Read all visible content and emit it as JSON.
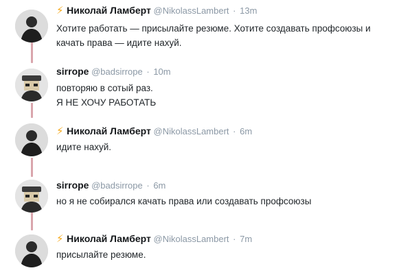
{
  "tweets": [
    {
      "author": "Николай Ламберт",
      "handle": "@NikolassLambert",
      "separator": "·",
      "time": "13m",
      "has_bolt": true,
      "lines": [
        "Хотите работать — присылайте резюме. Хотите создавать профсоюзы и",
        "качать права — идите нахуй."
      ]
    },
    {
      "author": "sirrope",
      "handle": "@badsirrope",
      "separator": "·",
      "time": "10m",
      "has_bolt": false,
      "lines": [
        "повторяю в сотый раз.",
        "Я НЕ ХОЧУ РАБОТАТЬ"
      ]
    },
    {
      "author": "Николай Ламберт",
      "handle": "@NikolassLambert",
      "separator": "·",
      "time": "6m",
      "has_bolt": true,
      "lines": [
        "идите нахуй."
      ]
    },
    {
      "author": "sirrope",
      "handle": "@badsirrope",
      "separator": "·",
      "time": "6m",
      "has_bolt": false,
      "lines": [
        "но я не собирался качать права или создавать профсоюзы"
      ]
    },
    {
      "author": "Николай Ламберт",
      "handle": "@NikolassLambert",
      "separator": "·",
      "time": "7m",
      "has_bolt": true,
      "lines": [
        "присылайте резюме."
      ]
    }
  ],
  "colors": {
    "name": "#14171a",
    "meta": "#8b98a5",
    "text": "#1f2428",
    "bolt": "#f5a91b",
    "connector": "#d9a5ac"
  },
  "icons": {
    "bolt": "lightning-bolt-icon"
  }
}
